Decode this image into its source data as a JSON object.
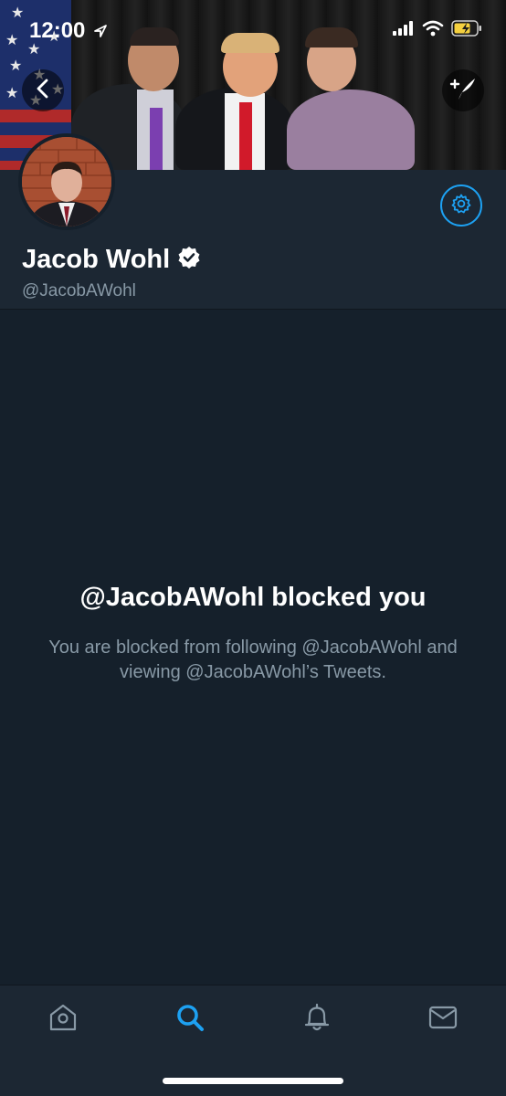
{
  "status_bar": {
    "time": "12:00",
    "icons": [
      "location-arrow-icon",
      "signal-icon",
      "wifi-icon",
      "battery-icon"
    ]
  },
  "header": {
    "back_icon": "chevron-left-icon",
    "compose_icon": "compose-tweet-icon"
  },
  "profile": {
    "name": "Jacob Wohl",
    "handle": "@JacobAWohl",
    "verified": true,
    "settings_icon": "gear-icon"
  },
  "blocked": {
    "title": "@JacobAWohl blocked you",
    "description": "You are blocked from following @JacobAWohl and viewing @JacobAWohl’s Tweets."
  },
  "tabbar": {
    "tabs": [
      {
        "name": "home",
        "icon": "home-icon",
        "active": false
      },
      {
        "name": "search",
        "icon": "search-icon",
        "active": true
      },
      {
        "name": "notifications",
        "icon": "bell-icon",
        "active": false
      },
      {
        "name": "messages",
        "icon": "envelope-icon",
        "active": false
      }
    ]
  },
  "colors": {
    "background": "#15202b",
    "panel": "#1c2733",
    "accent": "#1da1f2",
    "muted_text": "#8899a6"
  }
}
